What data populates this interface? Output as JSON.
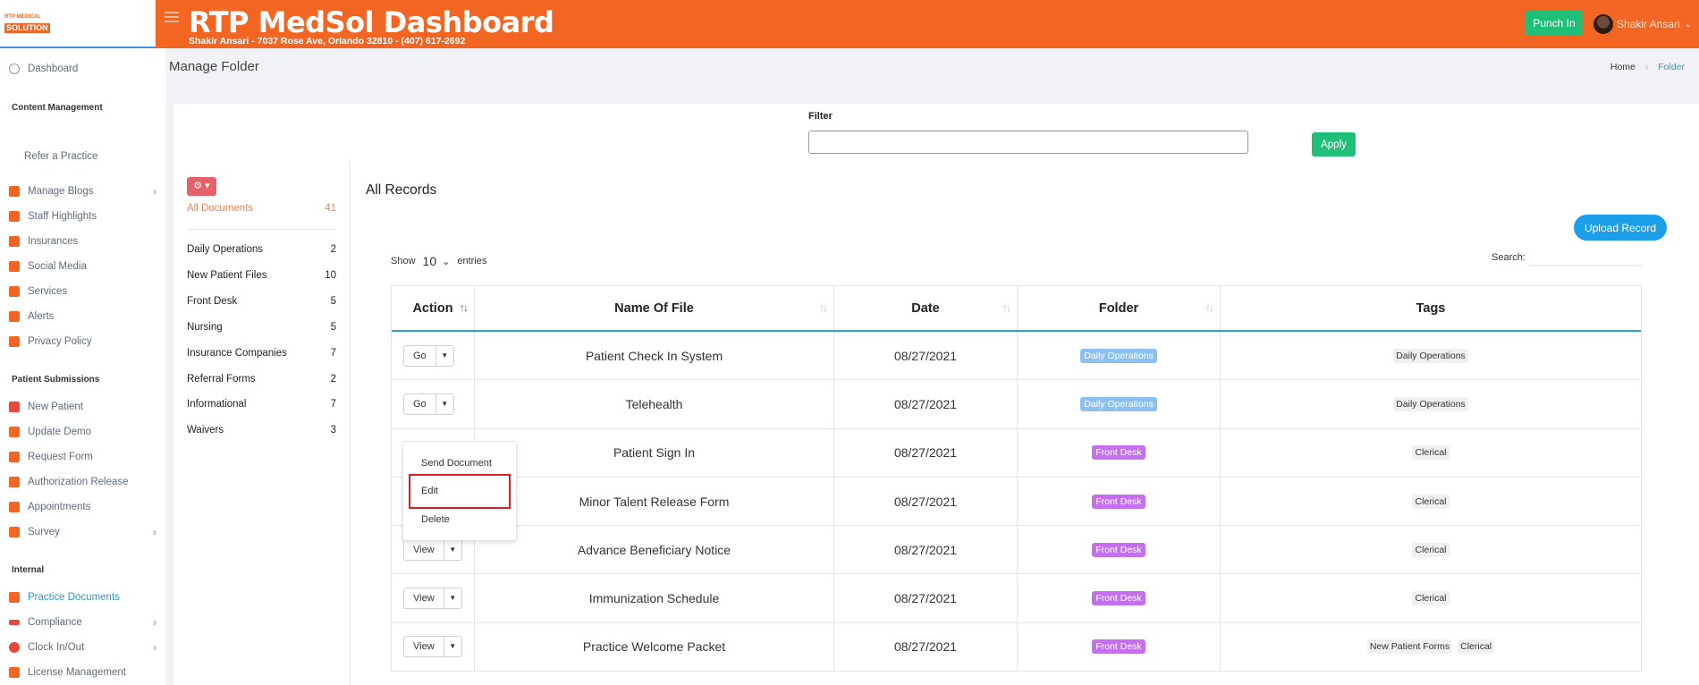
{
  "header": {
    "logo_line1": "RTP MEDICAL",
    "logo_line2": "SOLUTION",
    "title": "RTP MedSol Dashboard",
    "subtitle": "Shakir Ansari - 7037 Rose Ave, Orlando 32810 - (407) 617-2692",
    "punch_in": "Punch In",
    "user_name": "Shakir Ansari"
  },
  "sidebar": {
    "dashboard": "Dashboard",
    "section_content": "Content Management",
    "refer": "Refer a Practice",
    "content_items": [
      "Manage Blogs",
      "Staff Highlights",
      "Insurances",
      "Social Media",
      "Services",
      "Alerts",
      "Privacy Policy"
    ],
    "section_patient": "Patient Submissions",
    "patient_items": [
      "New Patient",
      "Update Demo",
      "Request Form",
      "Authorization Release",
      "Appointments",
      "Survey"
    ],
    "section_internal": "Internal",
    "internal_items": [
      "Practice Documents",
      "Compliance",
      "Clock In/Out",
      "License Management"
    ]
  },
  "page": {
    "title": "Manage Folder",
    "breadcrumb_home": "Home",
    "breadcrumb_current": "Folder"
  },
  "filter": {
    "label": "Filter",
    "value": "",
    "apply": "Apply"
  },
  "folders": {
    "all_label": "All Documents",
    "all_count": "41",
    "items": [
      {
        "name": "Daily Operations",
        "count": "2"
      },
      {
        "name": "New Patient Files",
        "count": "10"
      },
      {
        "name": "Front Desk",
        "count": "5"
      },
      {
        "name": "Nursing",
        "count": "5"
      },
      {
        "name": "Insurance Companies",
        "count": "7"
      },
      {
        "name": "Referral Forms",
        "count": "2"
      },
      {
        "name": "Informational",
        "count": "7"
      },
      {
        "name": "Waivers",
        "count": "3"
      }
    ]
  },
  "records": {
    "title": "All Records",
    "upload": "Upload Record",
    "show": "Show",
    "entries_value": "10",
    "entries": "entries",
    "search": "Search:",
    "columns": [
      "Action",
      "Name Of File",
      "Date",
      "Folder",
      "Tags"
    ],
    "rows": [
      {
        "action": "Go",
        "name": "Patient Check In System",
        "date": "08/27/2021",
        "folder": "Daily Operations",
        "tags": [
          "Daily Operations"
        ]
      },
      {
        "action": "Go",
        "name": "Telehealth",
        "date": "08/27/2021",
        "folder": "Daily Operations",
        "tags": [
          "Daily Operations"
        ]
      },
      {
        "action": "",
        "name": "Patient Sign In",
        "date": "08/27/2021",
        "folder": "Front Desk",
        "tags": [
          "Clerical"
        ]
      },
      {
        "action": "",
        "name": "Minor Talent Release Form",
        "date": "08/27/2021",
        "folder": "Front Desk",
        "tags": [
          "Clerical"
        ]
      },
      {
        "action": "View",
        "name": "Advance Beneficiary Notice",
        "date": "08/27/2021",
        "folder": "Front Desk",
        "tags": [
          "Clerical"
        ]
      },
      {
        "action": "View",
        "name": "Immunization Schedule",
        "date": "08/27/2021",
        "folder": "Front Desk",
        "tags": [
          "Clerical"
        ]
      },
      {
        "action": "View",
        "name": "Practice Welcome Packet",
        "date": "08/27/2021",
        "folder": "Front Desk",
        "tags": [
          "New Patient Forms",
          "Clerical"
        ]
      }
    ],
    "dropdown": [
      "Send Document",
      "Edit",
      "Delete"
    ]
  },
  "colors": {
    "brand": "#f26522",
    "success": "#1fbf7a",
    "primary": "#1a9fe8",
    "badge_daily": "#8bc0f0",
    "badge_front": "#c46ff0"
  }
}
